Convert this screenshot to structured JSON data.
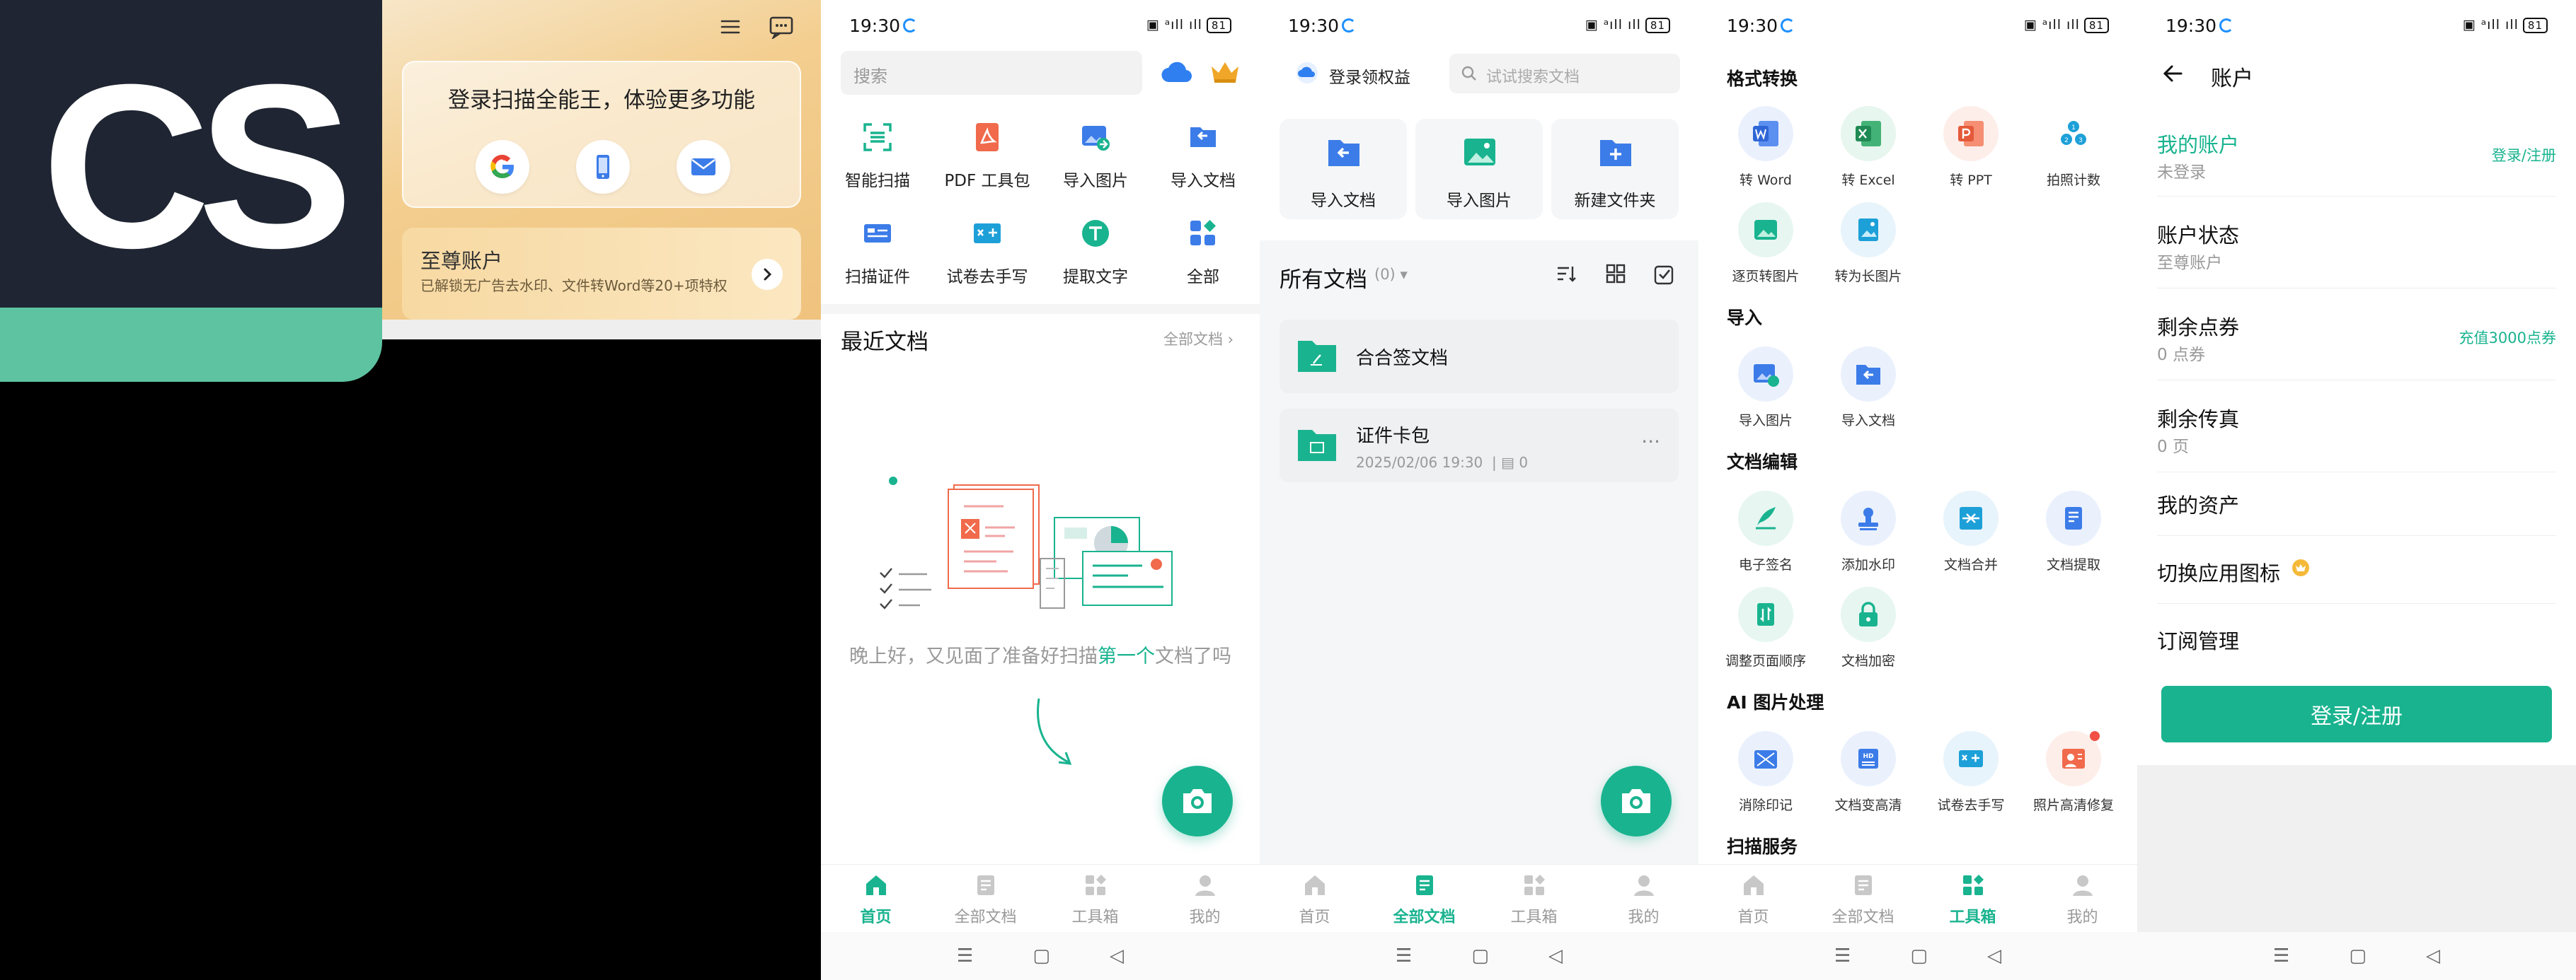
{
  "logo": {
    "text": "CS"
  },
  "login_panel": {
    "title": "登录扫描全能王，体验更多功能",
    "vip_title": "至尊账户",
    "vip_desc": "已解锁无广告去水印、文件转Word等20+项特权"
  },
  "status": {
    "time": "19:30",
    "battery": "81"
  },
  "home": {
    "search_placeholder": "搜索",
    "tools": [
      {
        "label": "智能扫描",
        "icon": "smart-scan-icon"
      },
      {
        "label": "PDF 工具包",
        "icon": "pdf-icon"
      },
      {
        "label": "导入图片",
        "icon": "import-image-icon"
      },
      {
        "label": "导入文档",
        "icon": "import-doc-icon"
      },
      {
        "label": "扫描证件",
        "icon": "id-card-icon"
      },
      {
        "label": "试卷去手写",
        "icon": "exam-icon"
      },
      {
        "label": "提取文字",
        "icon": "text-extract-icon"
      },
      {
        "label": "全部",
        "icon": "all-apps-icon"
      }
    ],
    "recent_title": "最近文档",
    "all_docs_link": "全部文档",
    "empty_text_a": "晚上好，又见面了准备好扫描",
    "empty_text_b": "第一个",
    "empty_text_c": "文档了吗"
  },
  "tabs": [
    {
      "label": "首页"
    },
    {
      "label": "全部文档"
    },
    {
      "label": "工具箱"
    },
    {
      "label": "我的"
    }
  ],
  "docs": {
    "login_benefit": "登录领权益",
    "search_placeholder": "试试搜索文档",
    "actions": [
      {
        "label": "导入文档"
      },
      {
        "label": "导入图片"
      },
      {
        "label": "新建文件夹"
      }
    ],
    "all_docs": "所有文档",
    "count": "(0)",
    "folders": [
      {
        "name": "合合签文档",
        "meta": "",
        "count": ""
      },
      {
        "name": "证件卡包",
        "meta": "2025/02/06 19:30",
        "count": "0"
      }
    ]
  },
  "toolbox": {
    "sections": [
      {
        "title": "格式转换",
        "items": [
          "转 Word",
          "转 Excel",
          "转 PPT",
          "拍照计数",
          "逐页转图片",
          "转为长图片"
        ]
      },
      {
        "title": "导入",
        "items": [
          "导入图片",
          "导入文档"
        ]
      },
      {
        "title": "文档编辑",
        "items": [
          "电子签名",
          "添加水印",
          "文档合并",
          "文档提取",
          "调整页面顺序",
          "文档加密"
        ]
      },
      {
        "title": "AI 图片处理",
        "items": [
          "消除印记",
          "文档变高清",
          "试卷去手写",
          "照片高清修复"
        ]
      },
      {
        "title": "扫描服务",
        "items": []
      }
    ]
  },
  "account": {
    "title": "账户",
    "rows": [
      {
        "label": "我的账户",
        "sub": "未登录",
        "action": "登录/注册"
      },
      {
        "label": "账户状态",
        "sub": "至尊账户",
        "action": ""
      },
      {
        "label": "剩余点券",
        "sub": "0 点券",
        "action": "充值3000点券"
      },
      {
        "label": "剩余传真",
        "sub": "0 页",
        "action": ""
      },
      {
        "label": "我的资产",
        "sub": "",
        "action": ""
      },
      {
        "label": "切换应用图标",
        "sub": "",
        "action": ""
      },
      {
        "label": "订阅管理",
        "sub": "",
        "action": ""
      }
    ],
    "login_button": "登录/注册"
  },
  "colors": {
    "accent": "#19b38f",
    "blue": "#3c7ce8",
    "red": "#f06a4b"
  }
}
